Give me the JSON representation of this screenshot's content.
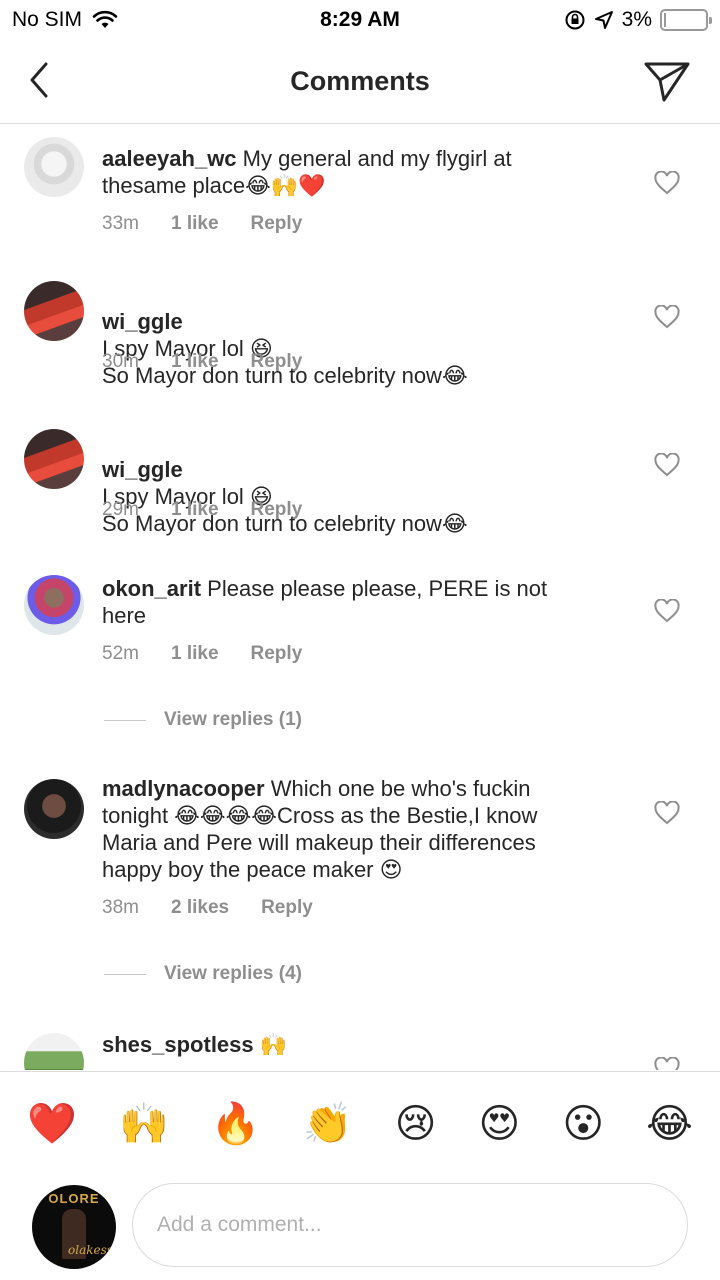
{
  "status_bar": {
    "carrier": "No SIM",
    "time": "8:29 AM",
    "battery": "3%",
    "battery_level": 0.03
  },
  "nav": {
    "title": "Comments"
  },
  "comments": [
    {
      "username": "aaleeyah_wc",
      "text": "My general and my flygirl at thesame place😂🙌❤️",
      "time": "33m",
      "likes": "1 like",
      "reply": "Reply"
    },
    {
      "username": "wi_ggle",
      "text": "I spy Mayor lol 😆\nSo Mayor don turn to celebrity now😂",
      "time": "30m",
      "likes": "1 like",
      "reply": "Reply"
    },
    {
      "username": "wi_ggle",
      "text": "I spy Mayor lol 😆\nSo Mayor don turn to celebrity now😂",
      "time": "29m",
      "likes": "1 like",
      "reply": "Reply"
    },
    {
      "username": "okon_arit",
      "text": "Please please please, PERE is not here",
      "time": "52m",
      "likes": "1 like",
      "reply": "Reply",
      "view_replies": "View replies (1)"
    },
    {
      "username": "madlynacooper",
      "text": "Which one be who's fuckin tonight 😂😂😂😂Cross as the Bestie,I know Maria and Pere will makeup their differences happy boy the peace maker 😍",
      "time": "38m",
      "likes": "2 likes",
      "reply": "Reply",
      "view_replies": "View replies (4)"
    },
    {
      "username": "shes_spotless",
      "text": "🙌"
    }
  ],
  "emoji_bar": [
    "❤️",
    "🙌",
    "🔥",
    "👏",
    "😢",
    "😍",
    "😮",
    "😂"
  ],
  "composer": {
    "placeholder": "Add a comment...",
    "avatar_title": "OLORE",
    "avatar_signature": "olakess"
  }
}
